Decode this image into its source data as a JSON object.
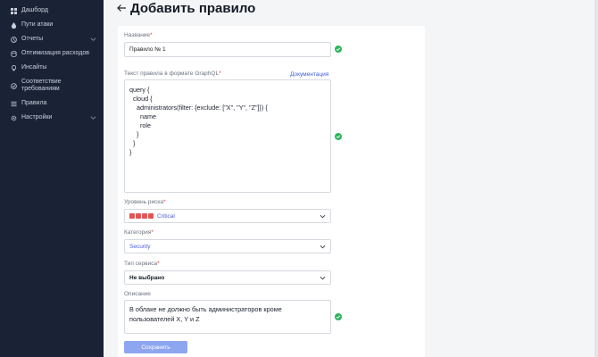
{
  "sidebar": {
    "items": [
      {
        "label": "Дашборд",
        "icon": "dashboard-icon"
      },
      {
        "label": "Пути атаки",
        "icon": "drop-icon"
      },
      {
        "label": "Отчеты",
        "icon": "clock-icon",
        "has_chevron": true
      },
      {
        "label": "Оптимизация расходов",
        "icon": "coins-icon"
      },
      {
        "label": "Инсайты",
        "icon": "bulb-icon"
      },
      {
        "label": "Соответствие требованиям",
        "icon": "check-circle-icon"
      },
      {
        "label": "Правила",
        "icon": "list-icon"
      },
      {
        "label": "Настройки",
        "icon": "gear-icon",
        "has_chevron": true
      }
    ]
  },
  "page": {
    "title": "Добавить правило"
  },
  "form": {
    "name": {
      "label": "Название",
      "required_mark": "*",
      "value": "Правило № 1"
    },
    "graphql": {
      "label": "Текст правила в формате GraphQL",
      "required_mark": "*",
      "doc_link": "Документация",
      "value": "query {\n  cloud {\n    administrators(filter: {exclude: [\"X\", \"Y\", \"Z\"]}) {\n      name\n      role\n    }\n  }\n}"
    },
    "risk": {
      "label": "Уровень риска",
      "required_mark": "*",
      "value": "Critical",
      "level": 4,
      "color": "#e05555"
    },
    "category": {
      "label": "Категория",
      "required_mark": "*",
      "value": "Security"
    },
    "service_type": {
      "label": "Тип сервиса",
      "required_mark": "*",
      "value": "Не выбрано"
    },
    "description": {
      "label": "Описание",
      "value": "В облаке не должно быть администраторов кроме\nпользователей X, Y и Z"
    },
    "save_label": "Сохранить"
  },
  "colors": {
    "accent": "#3f5bd6",
    "success": "#2db55d",
    "sidebar": "#1a2236",
    "save_button": "#8ea6f0"
  }
}
